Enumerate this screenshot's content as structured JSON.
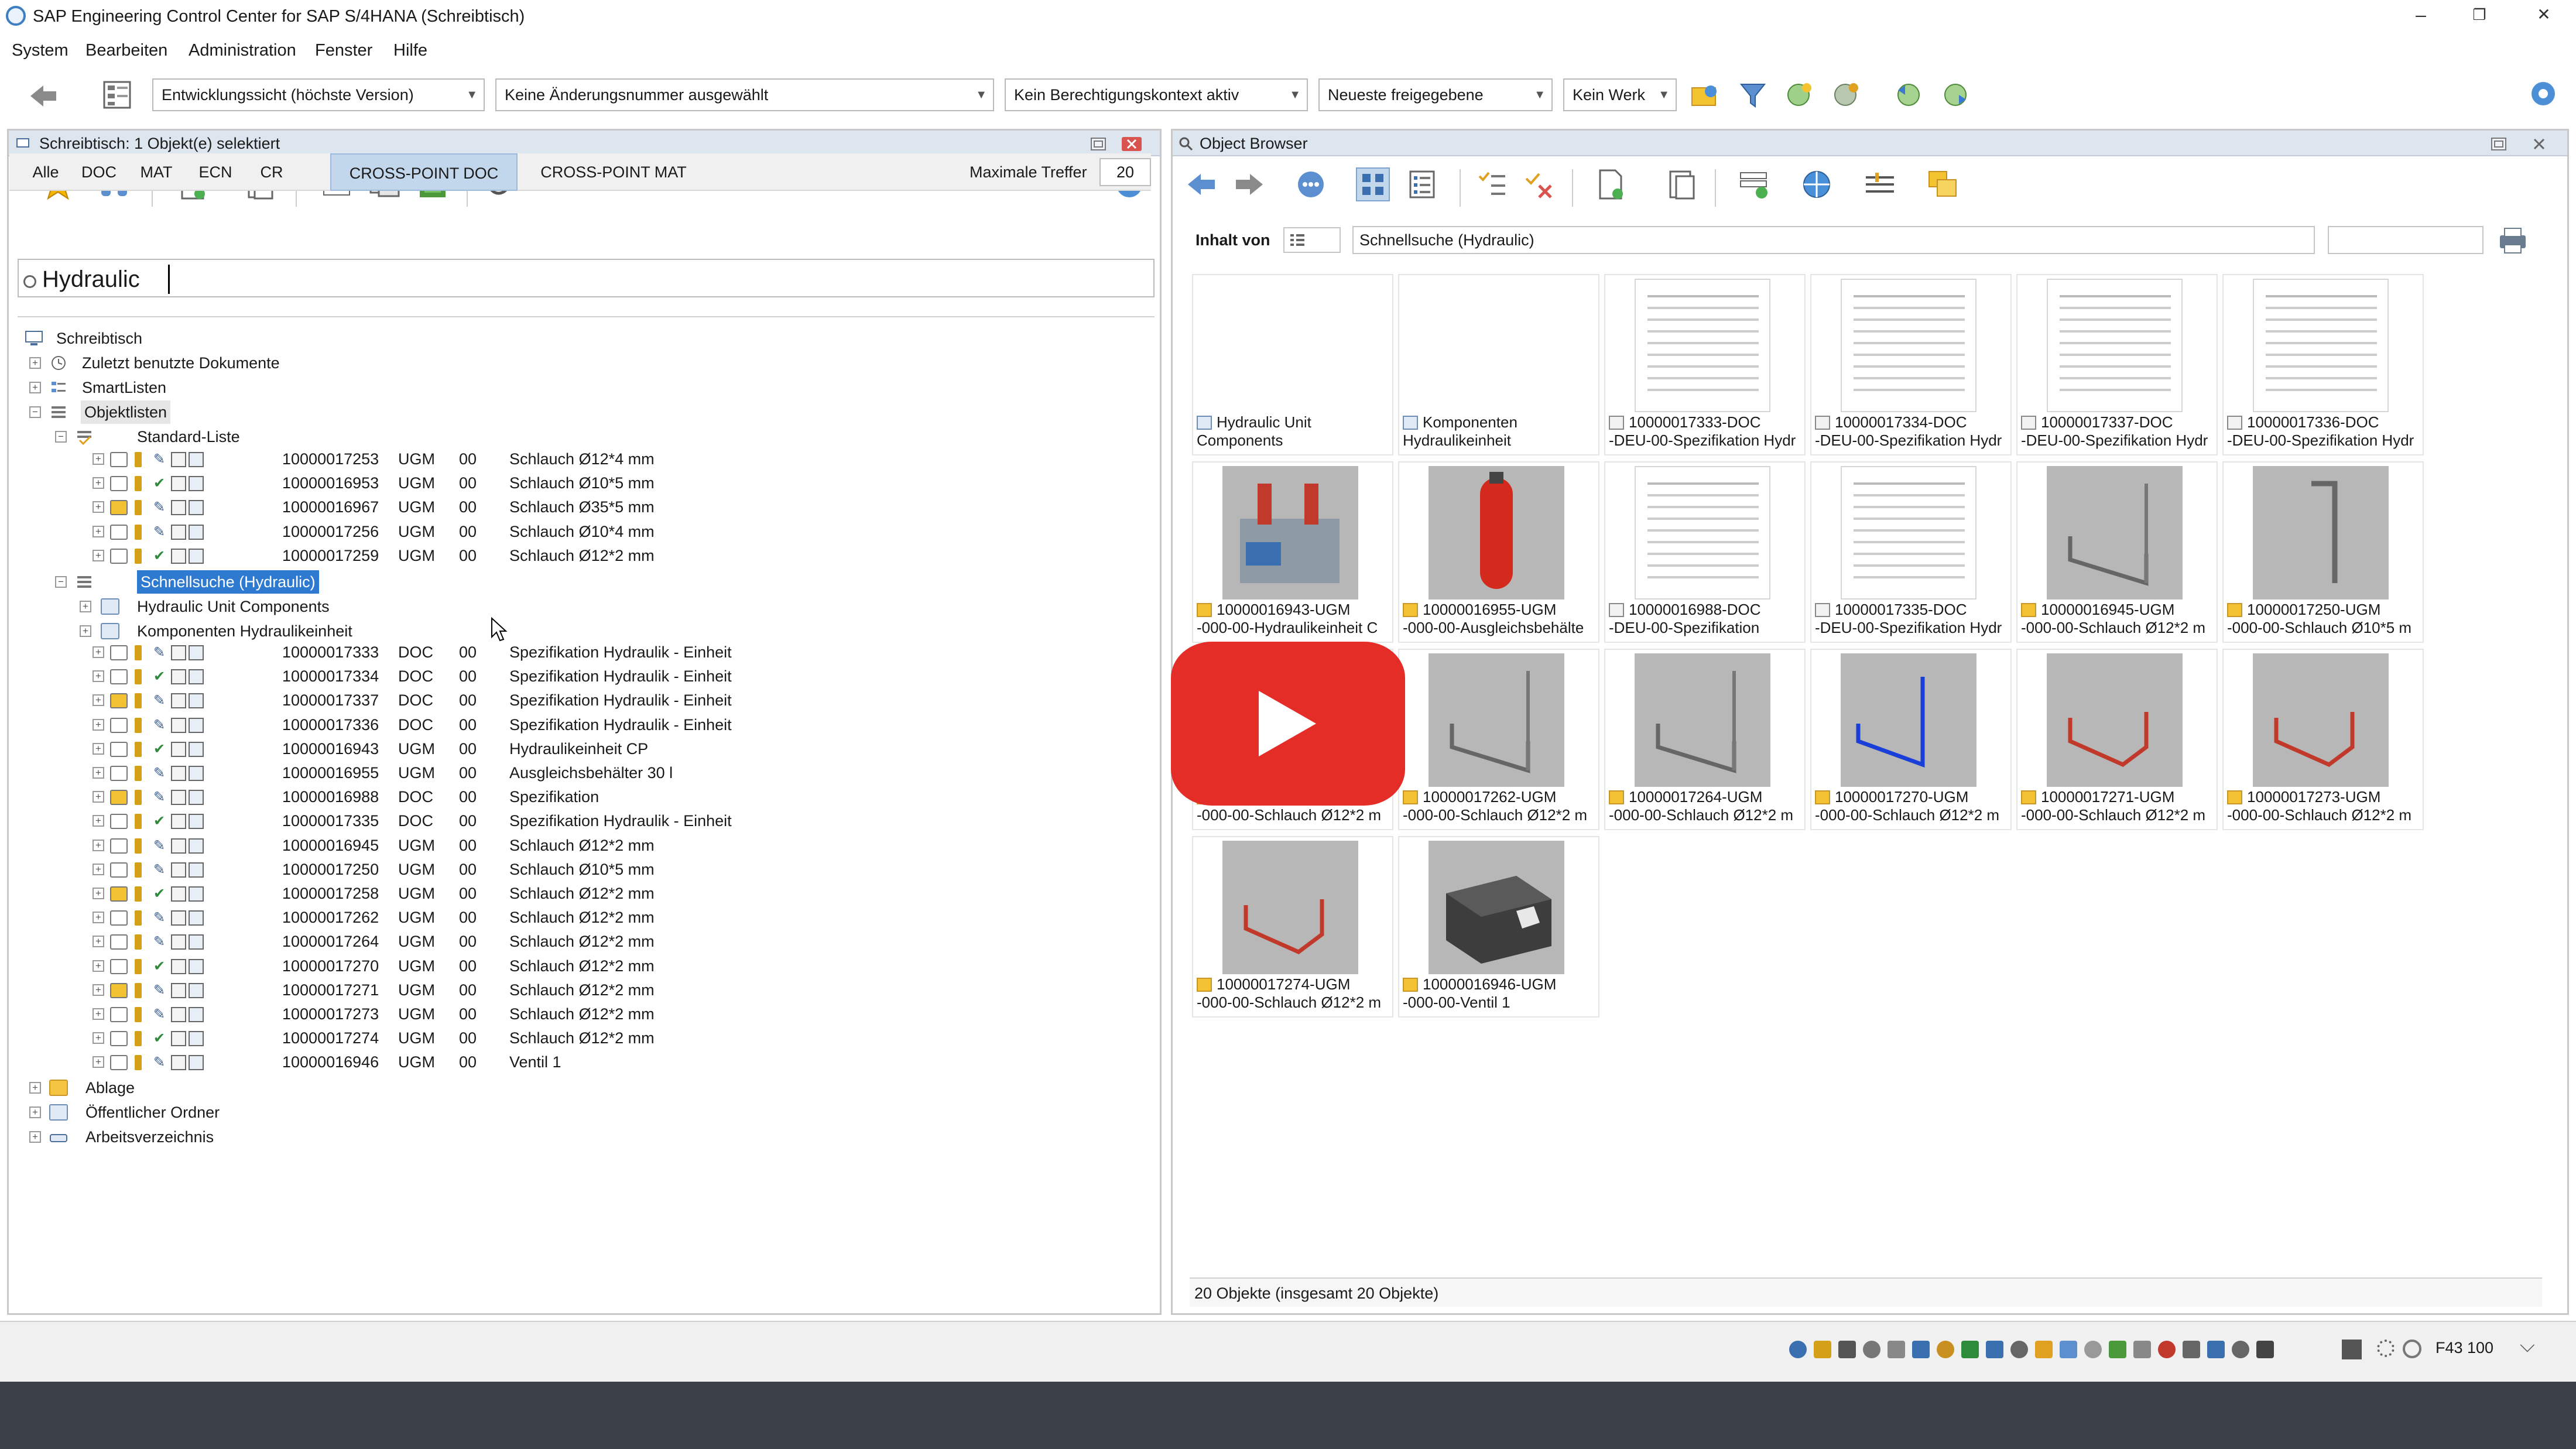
{
  "window": {
    "title": "SAP Engineering Control Center for SAP S/4HANA (Schreibtisch)",
    "min": "–",
    "max": "❐",
    "close": "✕"
  },
  "menu": [
    "System",
    "Bearbeiten",
    "Administration",
    "Fenster",
    "Hilfe"
  ],
  "toolbar": {
    "view": "Entwicklungssicht (höchste Version)",
    "change_number": "Keine Änderungsnummer ausgewählt",
    "auth_context": "Kein Berechtigungskontext aktiv",
    "release": "Neueste freigegebene",
    "plant": "Kein Werk"
  },
  "left_panel": {
    "title": "Schreibtisch: 1 Objekt(e) selektiert",
    "tabs": [
      "Alle",
      "DOC",
      "MAT",
      "ECN",
      "CR",
      "CROSS-POINT DOC",
      "CROSS-POINT MAT"
    ],
    "active_tab": "CROSS-POINT DOC",
    "max_hits_label": "Maximale Treffer",
    "max_hits_value": "20",
    "search_value": "Hydraulic",
    "tree": {
      "root": "Schreibtisch",
      "recent": "Zuletzt benutzte Dokumente",
      "smartlists": "SmartListen",
      "objectlists": "Objektlisten",
      "standard_list": "Standard-Liste",
      "quicksearch": "Schnellsuche (Hydraulic)",
      "folder_hydraulic": "Hydraulic Unit Components",
      "folder_komponenten": "Komponenten Hydraulikeinheit",
      "ablage": "Ablage",
      "public": "Öffentlicher Ordner",
      "workdir": "Arbeitsverzeichnis"
    },
    "standard_rows": [
      {
        "nr": "10000017253",
        "type": "UGM",
        "ver": "00",
        "desc": "Schlauch Ø12*4 mm"
      },
      {
        "nr": "10000016953",
        "type": "UGM",
        "ver": "00",
        "desc": "Schlauch Ø10*5 mm"
      },
      {
        "nr": "10000016967",
        "type": "UGM",
        "ver": "00",
        "desc": "Schlauch Ø35*5 mm"
      },
      {
        "nr": "10000017256",
        "type": "UGM",
        "ver": "00",
        "desc": "Schlauch Ø10*4 mm"
      },
      {
        "nr": "10000017259",
        "type": "UGM",
        "ver": "00",
        "desc": "Schlauch Ø12*2 mm"
      }
    ],
    "search_rows": [
      {
        "nr": "10000017333",
        "type": "DOC",
        "ver": "00",
        "desc": "Spezifikation Hydraulik - Einheit"
      },
      {
        "nr": "10000017334",
        "type": "DOC",
        "ver": "00",
        "desc": "Spezifikation Hydraulik - Einheit"
      },
      {
        "nr": "10000017337",
        "type": "DOC",
        "ver": "00",
        "desc": "Spezifikation Hydraulik - Einheit"
      },
      {
        "nr": "10000017336",
        "type": "DOC",
        "ver": "00",
        "desc": "Spezifikation Hydraulik - Einheit"
      },
      {
        "nr": "10000016943",
        "type": "UGM",
        "ver": "00",
        "desc": "Hydraulikeinheit CP"
      },
      {
        "nr": "10000016955",
        "type": "UGM",
        "ver": "00",
        "desc": "Ausgleichsbehälter 30 l"
      },
      {
        "nr": "10000016988",
        "type": "DOC",
        "ver": "00",
        "desc": "Spezifikation"
      },
      {
        "nr": "10000017335",
        "type": "DOC",
        "ver": "00",
        "desc": "Spezifikation Hydraulik - Einheit"
      },
      {
        "nr": "10000016945",
        "type": "UGM",
        "ver": "00",
        "desc": "Schlauch Ø12*2 mm"
      },
      {
        "nr": "10000017250",
        "type": "UGM",
        "ver": "00",
        "desc": "Schlauch Ø10*5 mm"
      },
      {
        "nr": "10000017258",
        "type": "UGM",
        "ver": "00",
        "desc": "Schlauch Ø12*2 mm"
      },
      {
        "nr": "10000017262",
        "type": "UGM",
        "ver": "00",
        "desc": "Schlauch Ø12*2 mm"
      },
      {
        "nr": "10000017264",
        "type": "UGM",
        "ver": "00",
        "desc": "Schlauch Ø12*2 mm"
      },
      {
        "nr": "10000017270",
        "type": "UGM",
        "ver": "00",
        "desc": "Schlauch Ø12*2 mm"
      },
      {
        "nr": "10000017271",
        "type": "UGM",
        "ver": "00",
        "desc": "Schlauch Ø12*2 mm"
      },
      {
        "nr": "10000017273",
        "type": "UGM",
        "ver": "00",
        "desc": "Schlauch Ø12*2 mm"
      },
      {
        "nr": "10000017274",
        "type": "UGM",
        "ver": "00",
        "desc": "Schlauch Ø12*2 mm"
      },
      {
        "nr": "10000016946",
        "type": "UGM",
        "ver": "00",
        "desc": "Ventil 1"
      }
    ]
  },
  "object_browser": {
    "title": "Object Browser",
    "content_label": "Inhalt von",
    "content_value": "Schnellsuche (Hydraulic)",
    "status": "20 Objekte (insgesamt 20 Objekte)",
    "tiles": [
      {
        "l1": "Hydraulic Unit",
        "l2": "Components",
        "kind": "folder"
      },
      {
        "l1": "Komponenten",
        "l2": "Hydraulikeinheit",
        "kind": "folder"
      },
      {
        "l1": "10000017333-DOC",
        "l2": "-DEU-00-Spezifikation Hydr",
        "kind": "doc"
      },
      {
        "l1": "10000017334-DOC",
        "l2": "-DEU-00-Spezifikation Hydr",
        "kind": "doc"
      },
      {
        "l1": "10000017337-DOC",
        "l2": "-DEU-00-Spezifikation Hydr",
        "kind": "doc"
      },
      {
        "l1": "10000017336-DOC",
        "l2": "-DEU-00-Spezifikation Hydr",
        "kind": "doc"
      },
      {
        "l1": "10000016943-UGM",
        "l2": "-000-00-Hydraulikeinheit C",
        "kind": "unit"
      },
      {
        "l1": "10000016955-UGM",
        "l2": "-000-00-Ausgleichsbehälte",
        "kind": "tank"
      },
      {
        "l1": "10000016988-DOC",
        "l2": "-DEU-00-Spezifikation",
        "kind": "doc"
      },
      {
        "l1": "10000017335-DOC",
        "l2": "-DEU-00-Spezifikation Hydr",
        "kind": "doc"
      },
      {
        "l1": "10000016945-UGM",
        "l2": "-000-00-Schlauch Ø12*2 m",
        "kind": "hose-gray"
      },
      {
        "l1": "10000017250-UGM",
        "l2": "-000-00-Schlauch Ø10*5 m",
        "kind": "hose-gray2"
      },
      {
        "l1": "",
        "l2": "-000-00-Schlauch Ø12*2 m",
        "kind": "hose-gray"
      },
      {
        "l1": "10000017262-UGM",
        "l2": "-000-00-Schlauch Ø12*2 m",
        "kind": "hose-gray"
      },
      {
        "l1": "10000017264-UGM",
        "l2": "-000-00-Schlauch Ø12*2 m",
        "kind": "hose-gray"
      },
      {
        "l1": "10000017270-UGM",
        "l2": "-000-00-Schlauch Ø12*2 m",
        "kind": "hose-blue"
      },
      {
        "l1": "10000017271-UGM",
        "l2": "-000-00-Schlauch Ø12*2 m",
        "kind": "hose-red"
      },
      {
        "l1": "10000017273-UGM",
        "l2": "-000-00-Schlauch Ø12*2 m",
        "kind": "hose-red"
      },
      {
        "l1": "10000017274-UGM",
        "l2": "-000-00-Schlauch Ø12*2 m",
        "kind": "hose-red"
      },
      {
        "l1": "10000016946-UGM",
        "l2": "-000-00-Ventil 1",
        "kind": "valve"
      }
    ]
  },
  "statusbar": {
    "server": "F43 100",
    "chevron": "⌵"
  },
  "colors": {
    "accent": "#2e7ad1",
    "play": "#e52d27",
    "panel_header": "#dde5ef"
  }
}
